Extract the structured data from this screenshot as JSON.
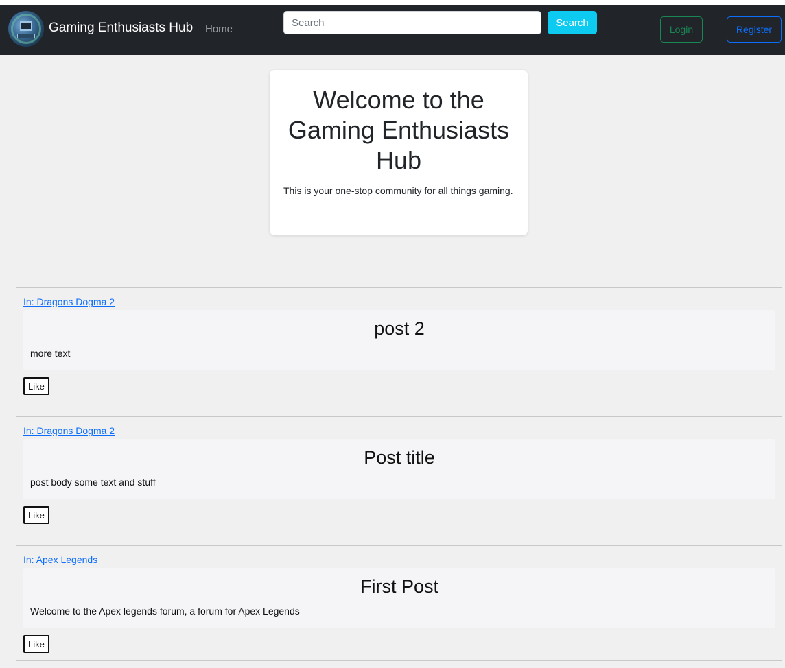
{
  "navbar": {
    "brand": "Gaming Enthusiasts Hub",
    "home_label": "Home",
    "search_placeholder": "Search",
    "search_button": "Search",
    "login_button": "Login",
    "register_button": "Register"
  },
  "hero": {
    "title": "Welcome to the Gaming Enthusiasts Hub",
    "subtitle": "This is your one-stop community for all things gaming."
  },
  "posts": [
    {
      "category": "In: Dragons Dogma 2",
      "title": "post 2",
      "body": "more text",
      "like_label": "Like"
    },
    {
      "category": "In: Dragons Dogma 2",
      "title": "Post title",
      "body": "post body some text and stuff",
      "like_label": "Like"
    },
    {
      "category": "In: Apex Legends",
      "title": "First Post",
      "body": "Welcome to the Apex legends forum, a forum for Apex Legends",
      "like_label": "Like"
    }
  ],
  "colors": {
    "navbar_bg": "#212529",
    "page_bg": "#f0f0f0",
    "search_button": "#0dcaf0",
    "login_outline": "#198754",
    "register_outline": "#0d6efd",
    "link": "#0d6efd"
  },
  "icons": {
    "logo": "gaming-computer-logo-icon"
  }
}
